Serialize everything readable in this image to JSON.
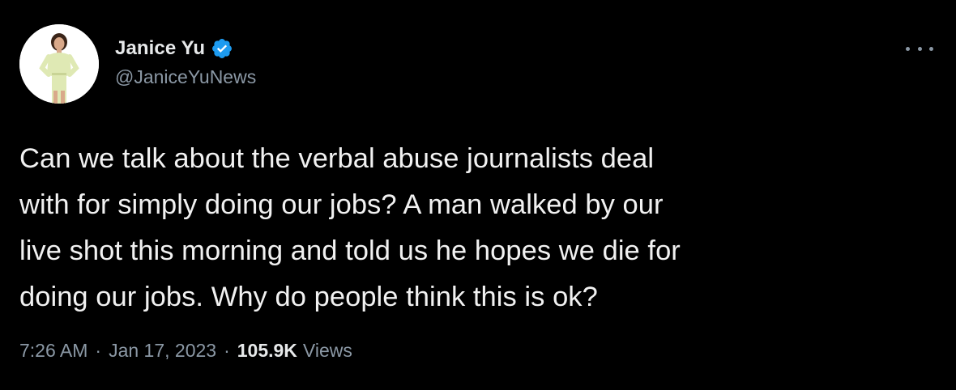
{
  "author": {
    "display_name": "Janice Yu",
    "handle": "@JaniceYuNews",
    "verified": true
  },
  "tweet": {
    "lines": [
      "Can we talk about the verbal abuse journalists deal",
      "with for simply doing our jobs? A man walked by our",
      "live shot this morning and told us he hopes we die for",
      "doing our jobs. Why do people think this is ok?"
    ],
    "time": "7:26 AM",
    "separator": "·",
    "date": "Jan 17, 2023",
    "views_count": "105.9K",
    "views_label": "Views"
  },
  "icons": {
    "verified": "verified-badge-icon",
    "more": "more-horizontal-icon"
  },
  "colors": {
    "background": "#000000",
    "primary_text": "#e7e9ea",
    "secondary_text": "#8b98a5",
    "verified_blue": "#1d9bf0"
  }
}
